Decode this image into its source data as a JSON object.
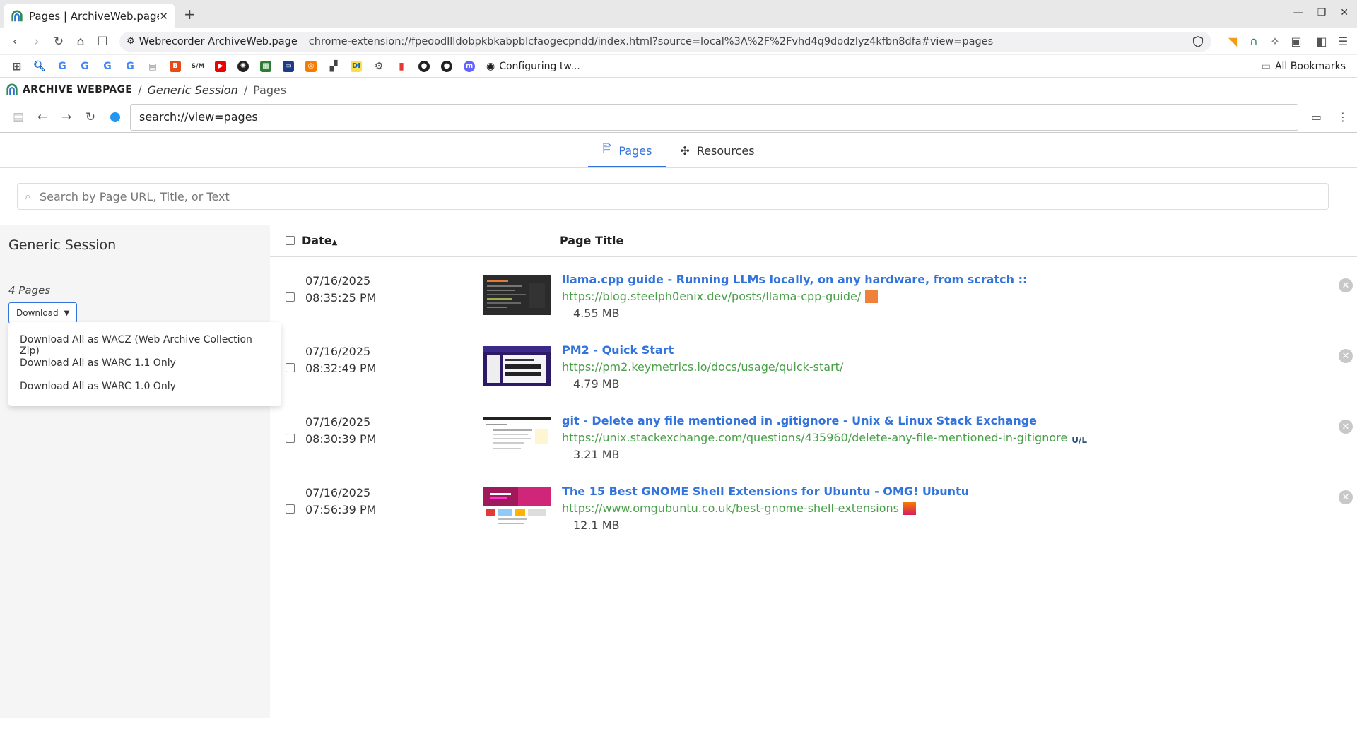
{
  "browser": {
    "tab_title": "Pages | ArchiveWeb.page",
    "site_name": "Webrecorder ArchiveWeb.page",
    "url": "chrome-extension://fpeoodllldobpkbkabpblcfaogecpndd/index.html?source=local%3A%2F%2Fvhd4q9dodzlyz4kfbn8dfa#view=pages",
    "bookmark_text": "Configuring tw...",
    "all_bookmarks": "All Bookmarks"
  },
  "app": {
    "logo_text": "ARCHIVE WEBPAGE",
    "crumb_session": "Generic Session",
    "crumb_pages": "Pages",
    "replay_url": "search://view=pages",
    "accent": "#3273dc"
  },
  "tabs": {
    "pages": "Pages",
    "resources": "Resources"
  },
  "search": {
    "placeholder": "Search by Page URL, Title, or Text"
  },
  "sidebar": {
    "title": "Generic Session",
    "count": "4 Pages",
    "download_label": "Download",
    "menu": [
      "Download All as WACZ (Web Archive Collection Zip)",
      "Download All as WARC 1.1 Only",
      "Download All as WARC 1.0 Only"
    ]
  },
  "table": {
    "col_date": "Date",
    "col_title": "Page Title",
    "rows": [
      {
        "date": "07/16/2025",
        "time": "08:35:25 PM",
        "title": "llama.cpp guide - Running LLMs locally, on any hardware, from scratch ::",
        "url": "https://blog.steelph0enix.dev/posts/llama-cpp-guide/",
        "size": "4.55 MB"
      },
      {
        "date": "07/16/2025",
        "time": "08:32:49 PM",
        "title": "PM2 - Quick Start",
        "url": "https://pm2.keymetrics.io/docs/usage/quick-start/",
        "size": "4.79 MB"
      },
      {
        "date": "07/16/2025",
        "time": "08:30:39 PM",
        "title": "git - Delete any file mentioned in .gitignore - Unix & Linux Stack Exchange",
        "url": "https://unix.stackexchange.com/questions/435960/delete-any-file-mentioned-in-gitignore",
        "size": "3.21 MB"
      },
      {
        "date": "07/16/2025",
        "time": "07:56:39 PM",
        "title": "The 15 Best GNOME Shell Extensions for Ubuntu - OMG! Ubuntu",
        "url": "https://www.omgubuntu.co.uk/best-gnome-shell-extensions",
        "size": "12.1 MB"
      }
    ]
  }
}
